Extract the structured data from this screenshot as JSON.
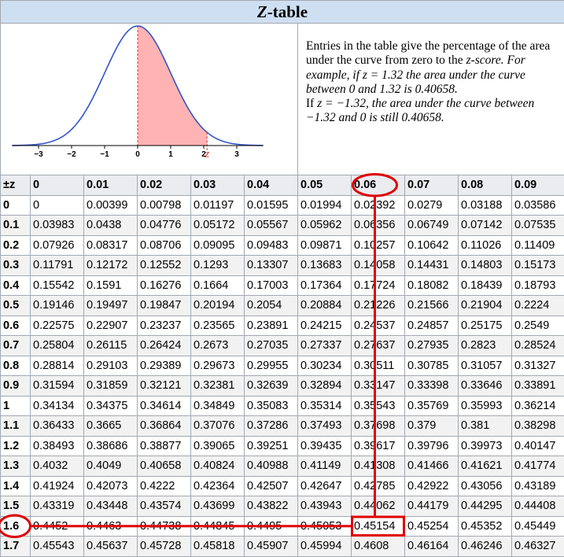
{
  "title_var": "Z",
  "title_rest": "-table",
  "description": [
    "Entries in the table give the percentage of the area under the curve from zero to the ",
    "z-score. For example, if ",
    "z = 1.32 the area under the curve between 0 and 1.32 is 0.40658.",
    "If ",
    "z = −1.32, the area under the curve between −1.32 and 0 is still 0.40658."
  ],
  "graph": {
    "x_ticks": [
      "−3",
      "−2",
      "−1",
      "0",
      "1",
      "2",
      "3"
    ],
    "z_marker": "z",
    "colors": {
      "curve": "#3355cc",
      "shade": "#ffb3b3",
      "marker": "#e8322a"
    }
  },
  "header": [
    "±z",
    "0",
    "0.01",
    "0.02",
    "0.03",
    "0.04",
    "0.05",
    "0.06",
    "0.07",
    "0.08",
    "0.09"
  ],
  "rows": [
    [
      "0",
      "0",
      "0.00399",
      "0.00798",
      "0.01197",
      "0.01595",
      "0.01994",
      "0.02392",
      "0.0279",
      "0.03188",
      "0.03586"
    ],
    [
      "0.1",
      "0.03983",
      "0.0438",
      "0.04776",
      "0.05172",
      "0.05567",
      "0.05962",
      "0.06356",
      "0.06749",
      "0.07142",
      "0.07535"
    ],
    [
      "0.2",
      "0.07926",
      "0.08317",
      "0.08706",
      "0.09095",
      "0.09483",
      "0.09871",
      "0.10257",
      "0.10642",
      "0.11026",
      "0.11409"
    ],
    [
      "0.3",
      "0.11791",
      "0.12172",
      "0.12552",
      "0.1293",
      "0.13307",
      "0.13683",
      "0.14058",
      "0.14431",
      "0.14803",
      "0.15173"
    ],
    [
      "0.4",
      "0.15542",
      "0.1591",
      "0.16276",
      "0.1664",
      "0.17003",
      "0.17364",
      "0.17724",
      "0.18082",
      "0.18439",
      "0.18793"
    ],
    [
      "0.5",
      "0.19146",
      "0.19497",
      "0.19847",
      "0.20194",
      "0.2054",
      "0.20884",
      "0.21226",
      "0.21566",
      "0.21904",
      "0.2224"
    ],
    [
      "0.6",
      "0.22575",
      "0.22907",
      "0.23237",
      "0.23565",
      "0.23891",
      "0.24215",
      "0.24537",
      "0.24857",
      "0.25175",
      "0.2549"
    ],
    [
      "0.7",
      "0.25804",
      "0.26115",
      "0.26424",
      "0.2673",
      "0.27035",
      "0.27337",
      "0.27637",
      "0.27935",
      "0.2823",
      "0.28524"
    ],
    [
      "0.8",
      "0.28814",
      "0.29103",
      "0.29389",
      "0.29673",
      "0.29955",
      "0.30234",
      "0.30511",
      "0.30785",
      "0.31057",
      "0.31327"
    ],
    [
      "0.9",
      "0.31594",
      "0.31859",
      "0.32121",
      "0.32381",
      "0.32639",
      "0.32894",
      "0.33147",
      "0.33398",
      "0.33646",
      "0.33891"
    ],
    [
      "1",
      "0.34134",
      "0.34375",
      "0.34614",
      "0.34849",
      "0.35083",
      "0.35314",
      "0.35543",
      "0.35769",
      "0.35993",
      "0.36214"
    ],
    [
      "1.1",
      "0.36433",
      "0.3665",
      "0.36864",
      "0.37076",
      "0.37286",
      "0.37493",
      "0.37698",
      "0.379",
      "0.381",
      "0.38298"
    ],
    [
      "1.2",
      "0.38493",
      "0.38686",
      "0.38877",
      "0.39065",
      "0.39251",
      "0.39435",
      "0.39617",
      "0.39796",
      "0.39973",
      "0.40147"
    ],
    [
      "1.3",
      "0.4032",
      "0.4049",
      "0.40658",
      "0.40824",
      "0.40988",
      "0.41149",
      "0.41308",
      "0.41466",
      "0.41621",
      "0.41774"
    ],
    [
      "1.4",
      "0.41924",
      "0.42073",
      "0.4222",
      "0.42364",
      "0.42507",
      "0.42647",
      "0.42785",
      "0.42922",
      "0.43056",
      "0.43189"
    ],
    [
      "1.5",
      "0.43319",
      "0.43448",
      "0.43574",
      "0.43699",
      "0.43822",
      "0.43943",
      "0.44062",
      "0.44179",
      "0.44295",
      "0.44408"
    ],
    [
      "1.6",
      "0.4452",
      "0.4463",
      "0.44738",
      "0.44845",
      "0.4495",
      "0.45053",
      "0.45154",
      "0.45254",
      "0.45352",
      "0.45449"
    ],
    [
      "1.7",
      "0.45543",
      "0.45637",
      "0.45728",
      "0.45818",
      "0.45907",
      "0.45994",
      "0.4608",
      "0.46164",
      "0.46246",
      "0.46327"
    ]
  ],
  "highlight": {
    "row_label": "1.6",
    "col_label": "0.06",
    "value": "0.45154",
    "color": "#e00000"
  }
}
